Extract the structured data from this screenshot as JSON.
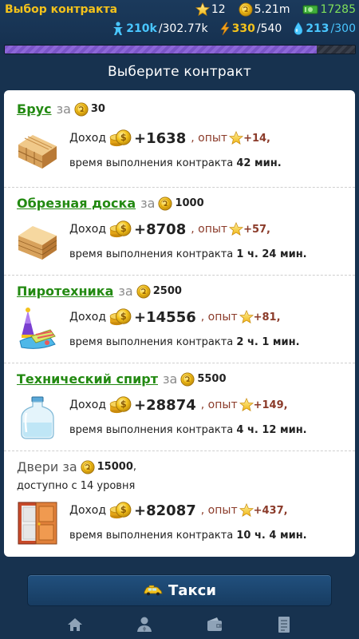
{
  "header": {
    "title": "Выбор контракта",
    "level": "12",
    "coins": "5.21m",
    "money": "17285",
    "population_current": "210k",
    "population_max": "/302.77k",
    "energy_current": "330",
    "energy_max": "/540",
    "water_current": "213",
    "water_max": "/300",
    "progress_fraction": 0.89
  },
  "subtitle": "Выберите контракт",
  "labels": {
    "za": "за",
    "income": "Доход",
    "opyt": ", опыт",
    "time_prefix": "время выполнения контракта"
  },
  "contracts": [
    {
      "name": "Брус",
      "price": "30",
      "income": "+1638",
      "xp": "+14,",
      "time": "42 мин.",
      "icon": "timber-icon"
    },
    {
      "name": "Обрезная доска",
      "price": "1000",
      "income": "+8708",
      "xp": "+57,",
      "time": "1 ч. 24 мин.",
      "icon": "planks-icon"
    },
    {
      "name": "Пиротехника",
      "price": "2500",
      "income": "+14556",
      "xp": "+81,",
      "time": "2 ч. 1 мин.",
      "icon": "fireworks-icon"
    },
    {
      "name": "Технический спирт",
      "price": "5500",
      "income": "+28874",
      "xp": "+149,",
      "time": "4 ч. 12 мин.",
      "icon": "alcohol-bottle-icon"
    },
    {
      "name": "Двери",
      "price": "15000",
      "income": "+82087",
      "xp": "+437,",
      "time": "10 ч. 4 мин.",
      "icon": "doors-icon",
      "locked_text": "доступно с 14 уровня"
    }
  ],
  "taxi_button": "Такси",
  "nav": [
    "home-icon",
    "person-icon",
    "wallet-icon",
    "list-icon"
  ]
}
